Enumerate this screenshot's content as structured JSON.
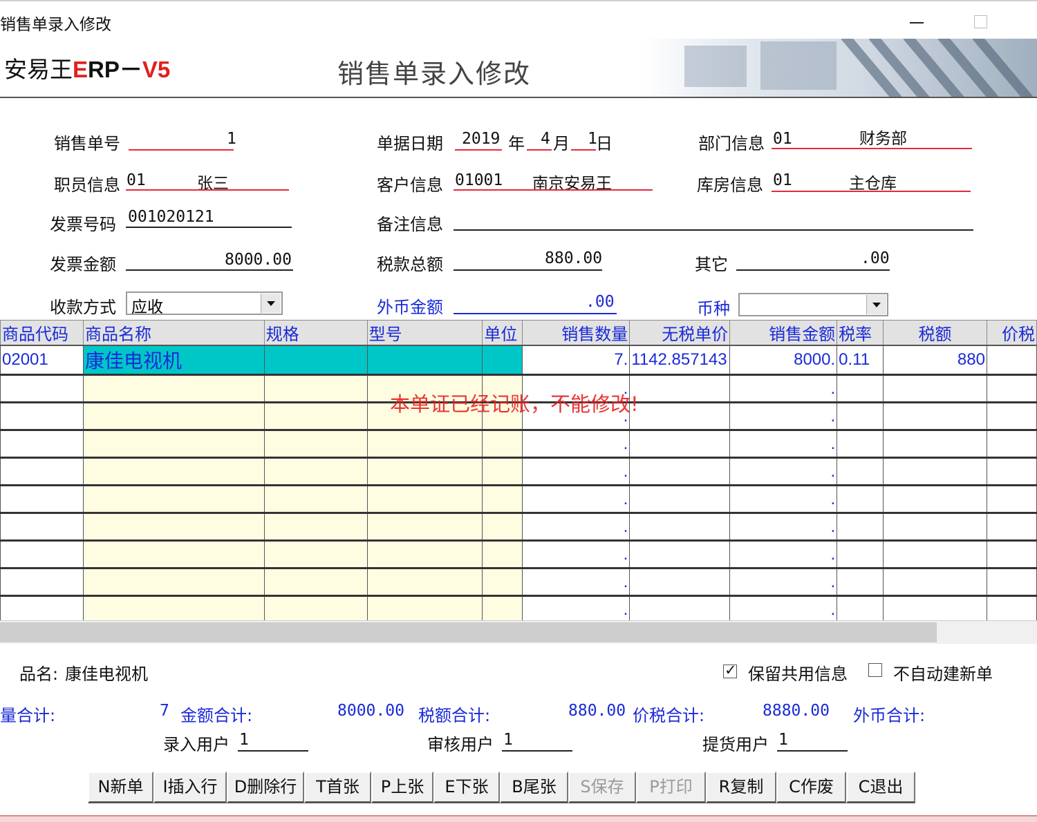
{
  "window": {
    "title": "销售单录入修改"
  },
  "banner": {
    "logo_cn": "安易王",
    "logo_e": "E",
    "logo_rp": "RP",
    "logo_dash": "－",
    "logo_v": "V5",
    "form_title": "销售单录入修改"
  },
  "form": {
    "sales_no": {
      "label": "销售单号",
      "value": "1"
    },
    "doc_date": {
      "label": "单据日期",
      "year": "2019",
      "year_unit": "年",
      "month": "4",
      "month_unit": "月",
      "day": "1",
      "day_unit": "日"
    },
    "dept": {
      "label": "部门信息",
      "code": "01",
      "name": "财务部"
    },
    "staff": {
      "label": "职员信息",
      "code": "01",
      "name": "张三"
    },
    "customer": {
      "label": "客户信息",
      "code": "01001",
      "name": "南京安易王"
    },
    "warehouse": {
      "label": "库房信息",
      "code": "01",
      "name": "主仓库"
    },
    "invoice_no": {
      "label": "发票号码",
      "value": "001020121"
    },
    "remark": {
      "label": "备注信息",
      "value": ""
    },
    "invoice_amount": {
      "label": "发票金额",
      "value": "8000.00"
    },
    "tax_total": {
      "label": "税款总额",
      "value": "880.00"
    },
    "other": {
      "label": "其它",
      "value": ".00"
    },
    "payment": {
      "label": "收款方式",
      "value": "应收"
    },
    "fx_amount": {
      "label": "外币金额",
      "value": ".00"
    },
    "currency": {
      "label": "币种",
      "value": ""
    }
  },
  "grid": {
    "columns": [
      "商品代码",
      "商品名称",
      "规格",
      "型号",
      "单位",
      "销售数量",
      "无税单价",
      "销售金额",
      "税率",
      "税额",
      "价税"
    ],
    "row1": {
      "code": "02001",
      "name": "康佳电视机",
      "spec": "",
      "model": "",
      "unit": "",
      "qty": "7.",
      "price": "1142.857143",
      "amount": "8000.",
      "rate": "0.11",
      "tax": "880",
      "total": ""
    },
    "empty_dot": ".",
    "posted_message": "本单证已经记账，不能修改!"
  },
  "bottom": {
    "product_name_label": "品名:",
    "product_name": "康佳电视机",
    "keep_shared": {
      "label": "保留共用信息",
      "checked": true
    },
    "no_auto_new": {
      "label": "不自动建新单",
      "checked": false
    },
    "qty_total_label": "量合计:",
    "qty_total": "7",
    "amount_total_label": "金额合计:",
    "amount_total": "8000.00",
    "tax_total_label": "税额合计:",
    "tax_total": "880.00",
    "gross_total_label": "价税合计:",
    "gross_total": "8880.00",
    "fx_total_label": "外币合计:",
    "entry_user_label": "录入用户",
    "entry_user": "1",
    "audit_user_label": "审核用户",
    "audit_user": "1",
    "pick_user_label": "提货用户",
    "pick_user": "1"
  },
  "toolbar": {
    "new": "N新单",
    "insert_row": "I插入行",
    "delete_row": "D删除行",
    "first": "T首张",
    "prev": "P上张",
    "next": "E下张",
    "last": "B尾张",
    "save": "S保存",
    "print": "P打印",
    "copy": "R复制",
    "void": "C作废",
    "exit": "C退出"
  }
}
